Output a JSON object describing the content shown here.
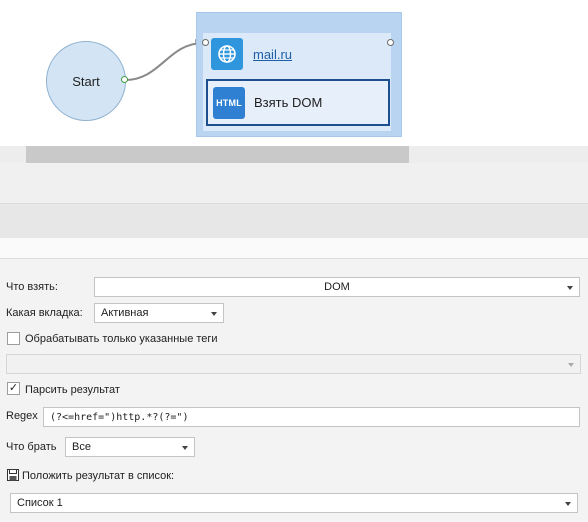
{
  "canvas": {
    "start_node": {
      "label": "Start"
    },
    "group": {
      "nodes": [
        {
          "label": "mail.ru",
          "icon": "globe-icon"
        },
        {
          "label": "Взять DOM",
          "icon": "html-icon",
          "badge": "HTML"
        }
      ]
    }
  },
  "properties": {
    "what_to_take": {
      "label": "Что взять:",
      "value": "DOM"
    },
    "tab": {
      "label": "Какая вкладка:",
      "value": "Активная"
    },
    "only_tags": {
      "label": "Обрабатывать только указанные теги",
      "checked": false,
      "value": ""
    },
    "parse_result": {
      "label": "Парсить результат",
      "checked": true,
      "check_mark": "✓"
    },
    "regex": {
      "label": "Regex",
      "value": "(?<=href=\")http.*?(?=\")"
    },
    "what_to_get": {
      "label": "Что брать",
      "value": "Все"
    },
    "save_to_list": {
      "label": "Положить результат в список:",
      "icon": "save-icon"
    },
    "list": {
      "value": "Список 1"
    }
  },
  "colors": {
    "group_bg": "#b9d4f1",
    "node_selected_border": "#1d4f8f",
    "globe_icon_bg": "#2f95dd",
    "html_icon_bg": "#2f80d3",
    "start_node_bg": "#d3e5f5",
    "link": "#1e5fa8"
  }
}
